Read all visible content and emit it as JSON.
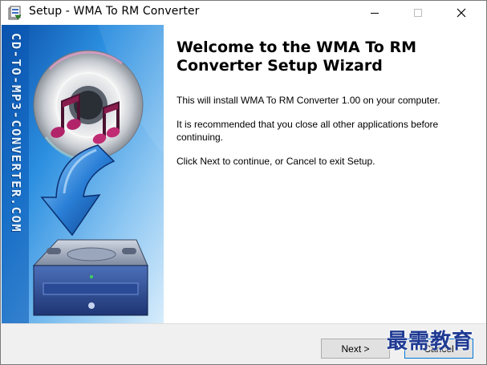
{
  "window": {
    "title": "Setup - WMA To RM Converter"
  },
  "banner": {
    "vertical_text": "CD-TO-MP3-CONVERTER.COM",
    "colors": {
      "dark_blue": "#0a4ea8",
      "mid_blue": "#2c8fe0",
      "light_blue": "#b9ddf7"
    }
  },
  "content": {
    "heading": "Welcome to the WMA To RM Converter Setup Wizard",
    "paragraph_install": "This will install WMA To RM Converter 1.00 on your computer.",
    "paragraph_recommend": "It is recommended that you close all other applications before continuing.",
    "paragraph_continue": "Click Next to continue, or Cancel to exit Setup."
  },
  "buttons": {
    "next_label": "Next >",
    "cancel_label": "Cancel"
  },
  "watermark": {
    "text": "最需教育"
  }
}
